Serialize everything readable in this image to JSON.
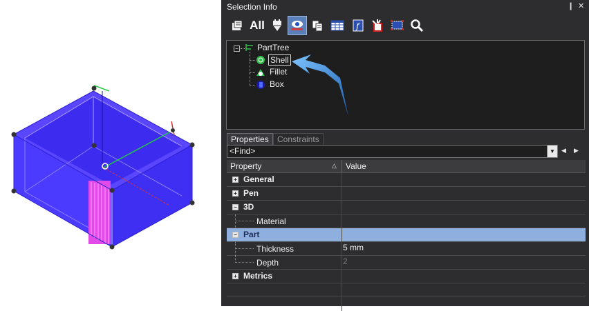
{
  "window": {
    "title": "Selection Info",
    "pin_glyph": "❙",
    "close_glyph": "✕"
  },
  "toolbar": {
    "all_label": "All",
    "buttons": [
      {
        "icon": "properties-icon"
      },
      {
        "icon": "all-label"
      },
      {
        "icon": "filter-plug-icon"
      },
      {
        "icon": "view-eye-icon",
        "active": true
      },
      {
        "icon": "copy-icon"
      },
      {
        "icon": "table-icon"
      },
      {
        "icon": "function-icon"
      },
      {
        "icon": "anchor-icon"
      },
      {
        "icon": "select-box-icon"
      },
      {
        "icon": "search-icon"
      }
    ]
  },
  "tree": {
    "root": "PartTree",
    "children": [
      "Shell",
      "Fillet",
      "Box"
    ],
    "selected": "Shell",
    "expander": "−"
  },
  "tabs": {
    "properties": "Properties",
    "constraints": "Constraints"
  },
  "find": {
    "placeholder": "<Find>",
    "dropdown_glyph": "▼",
    "prev_glyph": "◀",
    "next_glyph": "▶"
  },
  "grid": {
    "col_property": "Property",
    "col_value": "Value",
    "sort_glyph": "△",
    "rows": [
      {
        "label": "General",
        "expander": "+"
      },
      {
        "label": "Pen",
        "expander": "+"
      },
      {
        "label": "3D",
        "expander": "−"
      },
      {
        "label": "Material",
        "value": ""
      },
      {
        "label": "Part",
        "expander": "−"
      },
      {
        "label": "Thickness",
        "value": "5 mm"
      },
      {
        "label": "Depth",
        "value": "2"
      },
      {
        "label": "Metrics",
        "expander": "+"
      }
    ]
  },
  "colors": {
    "panel_bg": "#2d2d30",
    "selected_row": "#8fb0de",
    "model_fill": "#4a3dff",
    "arrow": "#3a8ee6"
  }
}
